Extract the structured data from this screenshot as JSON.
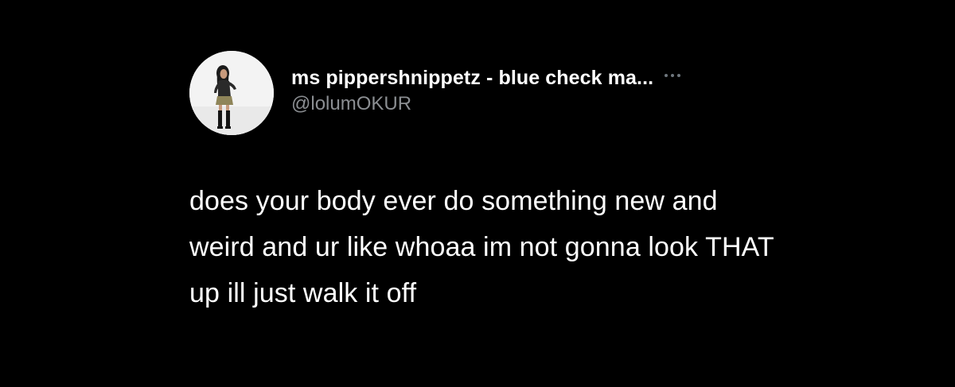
{
  "tweet": {
    "author": {
      "display_name": "ms pippershnippetz - blue check ma...",
      "handle": "@lolumOKUR",
      "avatar_icon": "profile-photo"
    },
    "more_icon": "more-horizontal-icon",
    "text": "does your body ever do something new and weird and ur like whoaa im not gonna look THAT up ill just walk it off"
  },
  "colors": {
    "background": "#000000",
    "text_primary": "#ffffff",
    "text_secondary": "#8b8e92",
    "icon_muted": "#6e767d"
  }
}
